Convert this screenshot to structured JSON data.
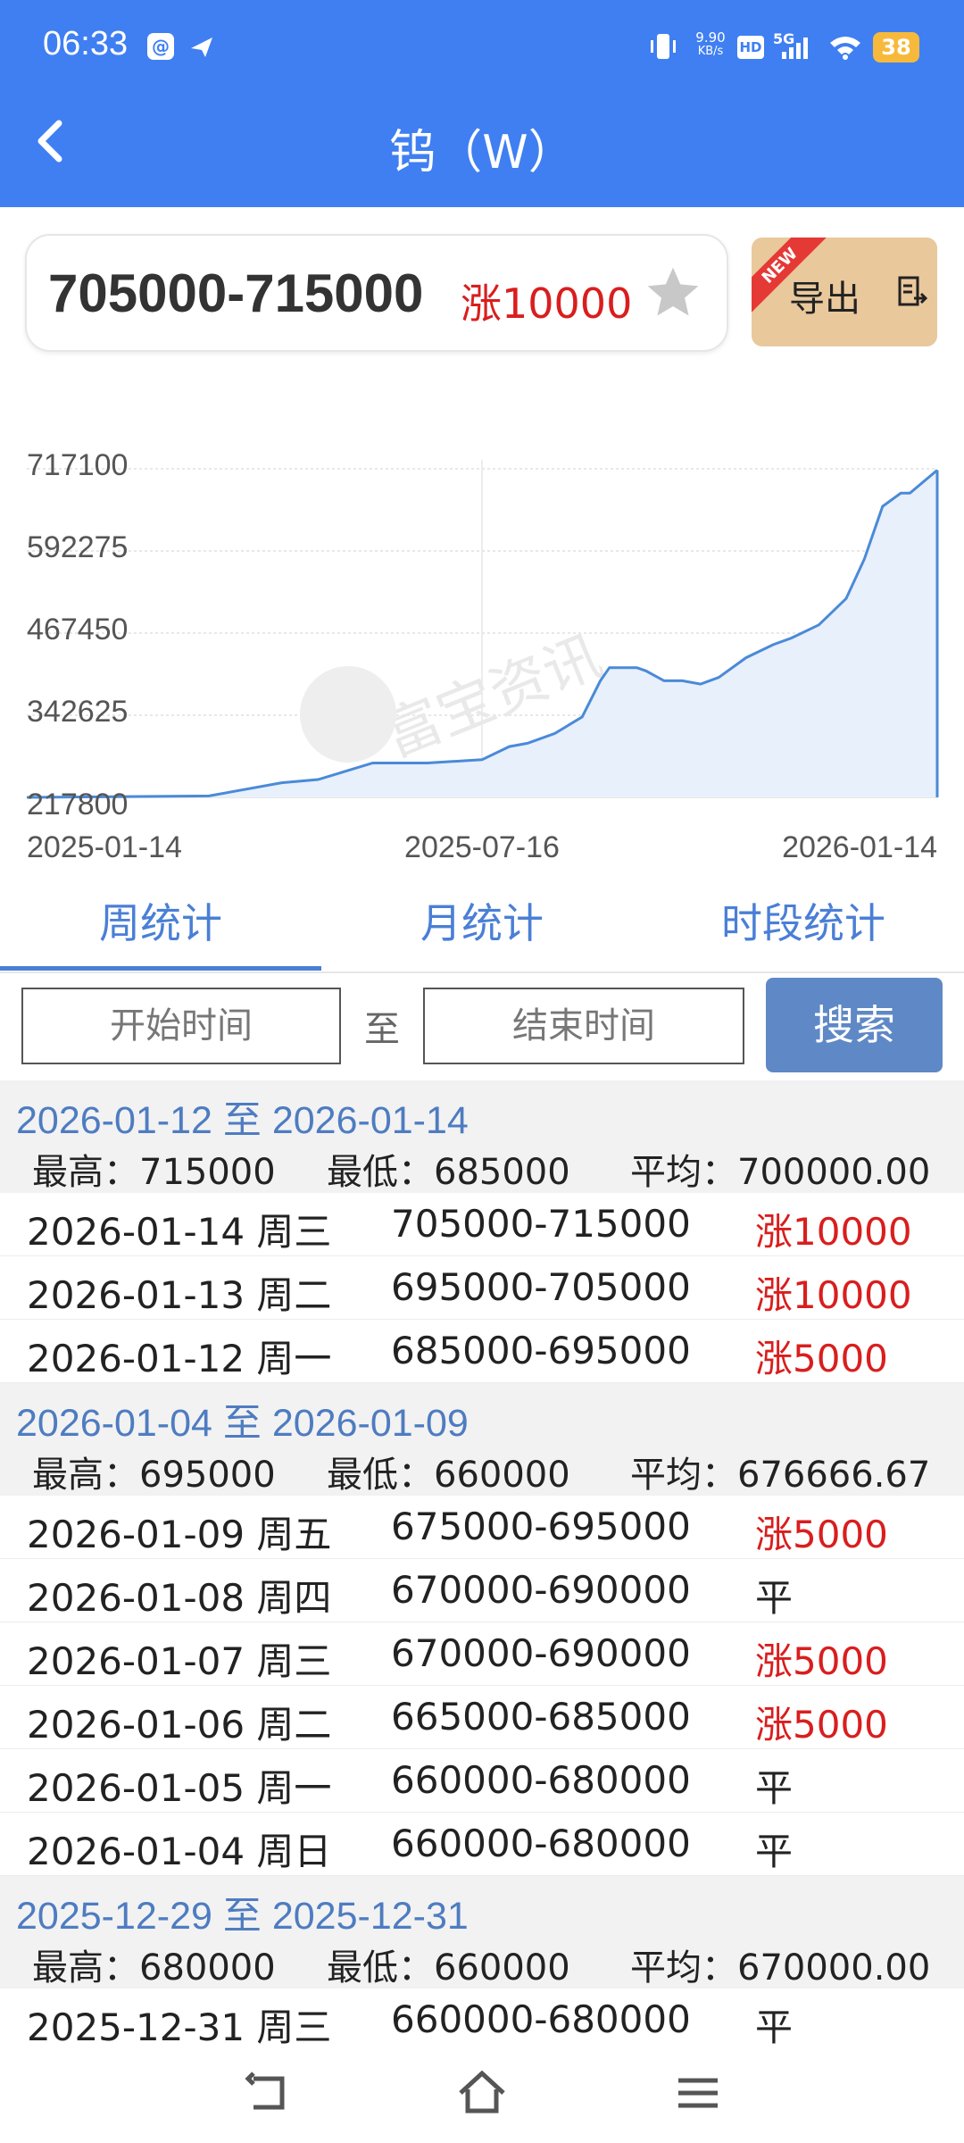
{
  "status": {
    "time": "06:33",
    "net_speed": "9.90",
    "net_unit": "KB/s",
    "hd": "HD",
    "five_g": "5G",
    "battery": "38"
  },
  "nav": {
    "title": "钨（W）"
  },
  "price": {
    "range": "705000-715000",
    "change": "涨10000"
  },
  "export": {
    "label": "导出",
    "badge": "NEW"
  },
  "chart_data": {
    "type": "area",
    "color": "#4a8ad8",
    "fill": "#e8f0fb",
    "y_ticks": [
      "717100",
      "592275",
      "467450",
      "342625",
      "217800"
    ],
    "x_ticks": [
      "2025-01-14",
      "2025-07-16",
      "2026-01-14"
    ],
    "ylim": [
      217800,
      717100
    ],
    "watermark": "富宝资讯",
    "x_frac": [
      0,
      0.2,
      0.28,
      0.32,
      0.38,
      0.4,
      0.44,
      0.5,
      0.53,
      0.55,
      0.58,
      0.61,
      0.63,
      0.64,
      0.67,
      0.68,
      0.7,
      0.72,
      0.74,
      0.76,
      0.79,
      0.82,
      0.84,
      0.87,
      0.9,
      0.92,
      0.94,
      0.96,
      0.97,
      1.0
    ],
    "values": [
      217800,
      220000,
      240000,
      245000,
      270000,
      270000,
      270000,
      275000,
      295000,
      300000,
      315000,
      340000,
      395000,
      415000,
      415000,
      410000,
      395000,
      395000,
      390000,
      400000,
      430000,
      450000,
      460000,
      480000,
      520000,
      580000,
      660000,
      680000,
      680000,
      715000
    ]
  },
  "tabs": [
    "周统计",
    "月统计",
    "时段统计"
  ],
  "search": {
    "start_placeholder": "开始时间",
    "to": "至",
    "end_placeholder": "结束时间",
    "button": "搜索"
  },
  "groups": [
    {
      "range": "2026-01-12 至 2026-01-14",
      "high": "最高：715000",
      "low": "最低：685000",
      "avg": "平均：700000.00",
      "rows": [
        {
          "date": "2026-01-14 周三",
          "range": "705000-715000",
          "change": "涨10000",
          "dir": "up"
        },
        {
          "date": "2026-01-13 周二",
          "range": "695000-705000",
          "change": "涨10000",
          "dir": "up"
        },
        {
          "date": "2026-01-12 周一",
          "range": "685000-695000",
          "change": "涨5000",
          "dir": "up"
        }
      ]
    },
    {
      "range": "2026-01-04 至 2026-01-09",
      "high": "最高：695000",
      "low": "最低：660000",
      "avg": "平均：676666.67",
      "rows": [
        {
          "date": "2026-01-09 周五",
          "range": "675000-695000",
          "change": "涨5000",
          "dir": "up"
        },
        {
          "date": "2026-01-08 周四",
          "range": "670000-690000",
          "change": "平",
          "dir": "flat"
        },
        {
          "date": "2026-01-07 周三",
          "range": "670000-690000",
          "change": "涨5000",
          "dir": "up"
        },
        {
          "date": "2026-01-06 周二",
          "range": "665000-685000",
          "change": "涨5000",
          "dir": "up"
        },
        {
          "date": "2026-01-05 周一",
          "range": "660000-680000",
          "change": "平",
          "dir": "flat"
        },
        {
          "date": "2026-01-04 周日",
          "range": "660000-680000",
          "change": "平",
          "dir": "flat"
        }
      ]
    },
    {
      "range": "2025-12-29 至 2025-12-31",
      "high": "最高：680000",
      "low": "最低：660000",
      "avg": "平均：670000.00",
      "rows": [
        {
          "date": "2025-12-31 周三",
          "range": "660000-680000",
          "change": "平",
          "dir": "flat"
        }
      ]
    }
  ]
}
